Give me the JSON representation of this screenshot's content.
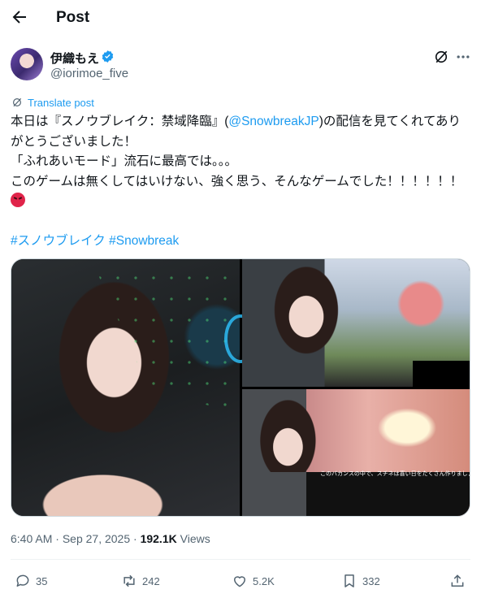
{
  "header": {
    "title": "Post",
    "back_icon": "arrow-left-icon"
  },
  "author": {
    "display_name": "伊織もえ",
    "handle": "@iorimoe_five",
    "verified_color": "#1d9bf0"
  },
  "translate": {
    "label": "Translate post"
  },
  "tweet": {
    "line1_pre": "本日は『スノウブレイク：禁域降臨』(",
    "mention": "@SnowbreakJP",
    "line1_post": ")の配信を見てくれてありがとうございました！",
    "line2": "「ふれあいモード」流石に最高では。。。",
    "line3": "このゲームは無くしてはいけない、強く思う、そんなゲームでした！！！！！！",
    "hashtags": "#スノウブレイク #Snowbreak"
  },
  "media": {
    "caption": "このバカンスの中で、スチネは喜い日をたくさん作りましょうね！"
  },
  "meta": {
    "time": "6:40 AM",
    "separator": " · ",
    "date": "Sep 27, 2025",
    "views_count": "192.1K",
    "views_label": " Views"
  },
  "actions": {
    "replies": "35",
    "reposts": "242",
    "likes": "5.2K",
    "bookmarks": "332"
  },
  "colors": {
    "accent": "#1d9bf0",
    "secondary_text": "#536471",
    "text": "#0f1419"
  }
}
